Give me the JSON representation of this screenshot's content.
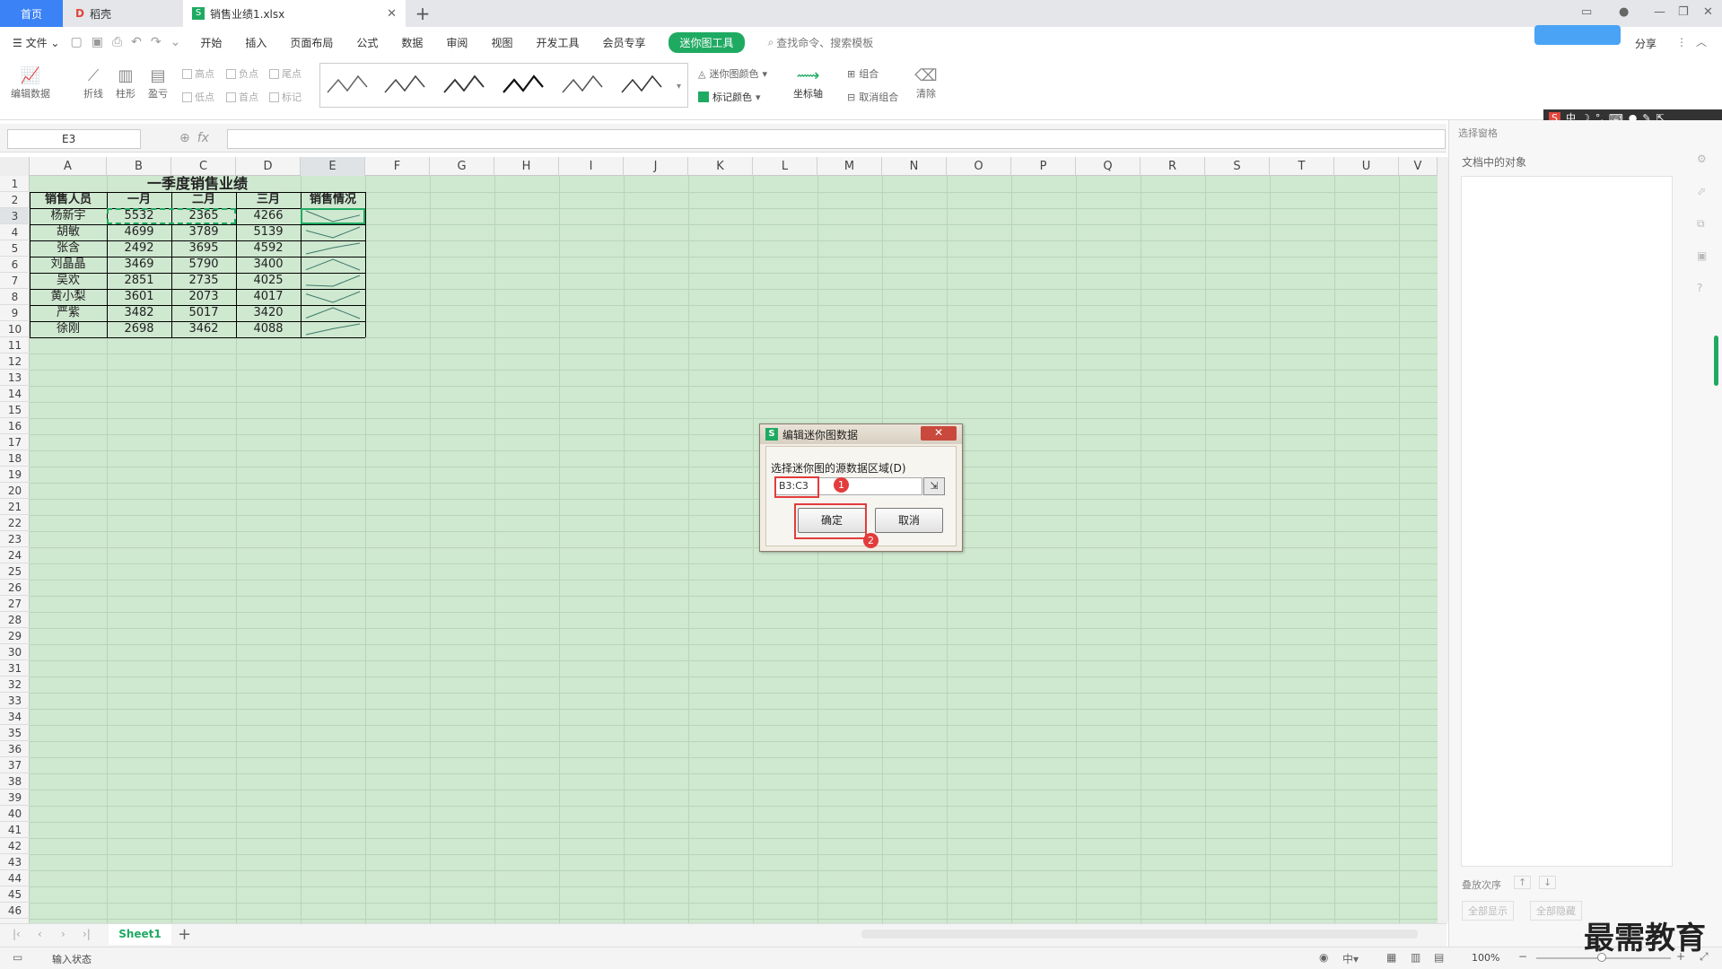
{
  "tabs": {
    "home": "首页",
    "docer": "稻壳",
    "file": "销售业绩1.xlsx"
  },
  "menu": [
    "开始",
    "插入",
    "页面布局",
    "公式",
    "数据",
    "审阅",
    "视图",
    "开发工具",
    "会员专享"
  ],
  "menu_file": "文件",
  "sparkline_tools_tab": "迷你图工具",
  "search_placeholder": "查找命令、搜索模板",
  "share_label": "分享",
  "ribbon": {
    "edit_data": "编辑数据",
    "line": "折线",
    "column": "柱形",
    "winloss": "盈亏",
    "checks": [
      "高点",
      "负点",
      "尾点",
      "低点",
      "首点",
      "标记"
    ],
    "sparkline_color": "迷你图颜色",
    "marker_color": "标记颜色",
    "axis": "坐标轴",
    "group": "组合",
    "ungroup": "取消组合",
    "clear": "清除"
  },
  "name_box": "E3",
  "fx_label": "fx",
  "columns": [
    "A",
    "B",
    "C",
    "D",
    "E",
    "F",
    "G",
    "H",
    "I",
    "J",
    "K",
    "L",
    "M",
    "N",
    "O",
    "P",
    "Q",
    "R",
    "S",
    "T",
    "U",
    "V"
  ],
  "rows": [
    "1",
    "2",
    "3",
    "4",
    "5",
    "6",
    "7",
    "8",
    "9",
    "10",
    "11",
    "12",
    "13",
    "14",
    "15",
    "16",
    "17",
    "18",
    "19",
    "20",
    "21",
    "22",
    "23",
    "24",
    "25",
    "26",
    "27",
    "28",
    "29",
    "30",
    "31",
    "32",
    "33",
    "34",
    "35",
    "36",
    "37",
    "38",
    "39",
    "40",
    "41",
    "42",
    "43",
    "44",
    "45",
    "46"
  ],
  "sheet": {
    "title": "一季度销售业绩",
    "headers": [
      "销售人员",
      "一月",
      "二月",
      "三月",
      "销售情况"
    ],
    "data": [
      [
        "杨新宇",
        "5532",
        "2365",
        "4266"
      ],
      [
        "胡敏",
        "4699",
        "3789",
        "5139"
      ],
      [
        "张含",
        "2492",
        "3695",
        "4592"
      ],
      [
        "刘晶晶",
        "3469",
        "5790",
        "3400"
      ],
      [
        "吴欢",
        "2851",
        "2735",
        "4025"
      ],
      [
        "黄小梨",
        "3601",
        "2073",
        "4017"
      ],
      [
        "严紫",
        "3482",
        "5017",
        "3420"
      ],
      [
        "徐刚",
        "2698",
        "3462",
        "4088"
      ]
    ]
  },
  "sheet_tab": "Sheet1",
  "status": {
    "mode": "输入状态",
    "zoom": "100%"
  },
  "right_pane": {
    "title": "选择窗格",
    "objects_label": "文档中的对象",
    "stack_order": "叠放次序",
    "show_all": "全部显示",
    "hide_all": "全部隐藏"
  },
  "dialog": {
    "title": "编辑迷你图数据",
    "prompt": "选择迷你图的源数据区域(D)",
    "range": "B3:C3",
    "ok": "确定",
    "cancel": "取消",
    "badge1": "1",
    "badge2": "2"
  },
  "watermark": "最需教育",
  "colors": {
    "accent": "#1faa62",
    "grid_bg": "#cfe8d0",
    "highlight": "#e23c3c",
    "home_tab": "#3b82f6"
  }
}
